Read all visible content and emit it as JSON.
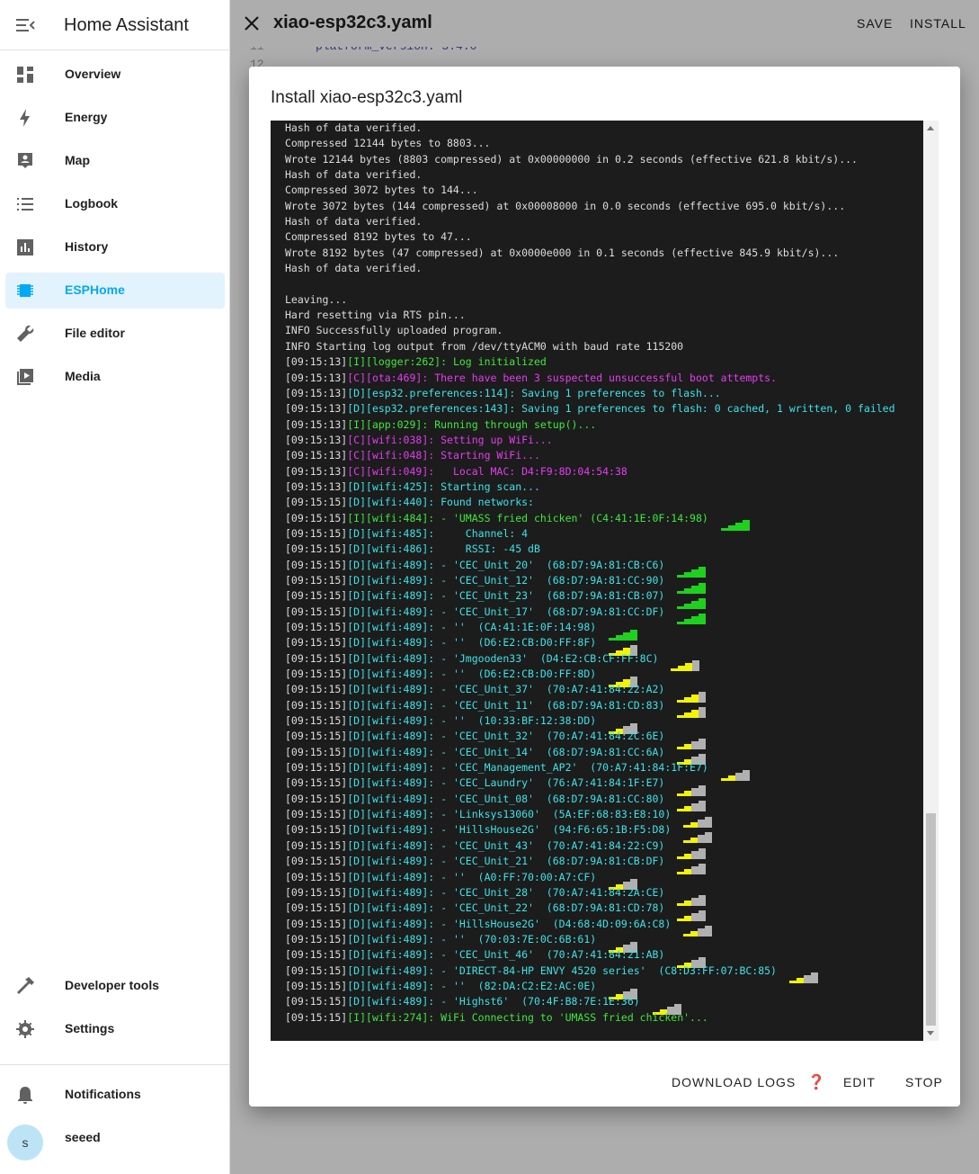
{
  "sidebar": {
    "title": "Home Assistant",
    "items": [
      {
        "label": "Overview",
        "icon": "overview-icon",
        "name": "overview"
      },
      {
        "label": "Energy",
        "icon": "energy-icon",
        "name": "energy"
      },
      {
        "label": "Map",
        "icon": "map-icon",
        "name": "map"
      },
      {
        "label": "Logbook",
        "icon": "logbook-icon",
        "name": "logbook"
      },
      {
        "label": "History",
        "icon": "history-icon",
        "name": "history"
      },
      {
        "label": "ESPHome",
        "icon": "esphome-icon",
        "name": "esphome",
        "active": true
      },
      {
        "label": "File editor",
        "icon": "wrench-icon",
        "name": "file-editor"
      },
      {
        "label": "Media",
        "icon": "media-icon",
        "name": "media"
      }
    ],
    "bottom_items": [
      {
        "label": "Developer tools",
        "icon": "hammer-icon",
        "name": "developer-tools"
      },
      {
        "label": "Settings",
        "icon": "gear-icon",
        "name": "settings"
      }
    ],
    "notifications_label": "Notifications",
    "user": {
      "initial": "s",
      "name": "seeed"
    }
  },
  "editor": {
    "file_title": "xiao-esp32c3.yaml",
    "save_label": "SAVE",
    "install_label": "INSTALL",
    "line_11": "11",
    "line_11_text": "platform_version: 5.4.0",
    "line_12": "12"
  },
  "dialog": {
    "title": "Install xiao-esp32c3.yaml",
    "download_logs_label": "DOWNLOAD LOGS",
    "help_glyph": "❓",
    "edit_label": "EDIT",
    "stop_label": "STOP"
  },
  "colors": {
    "accent": "#03a9f4",
    "log_bg": "#1c1c1c",
    "log_green": "#3ee83e",
    "log_magenta": "#e53cf0",
    "log_cyan": "#3de3e8",
    "signal_green": "#1fd11f",
    "signal_yellow": "#f4f400",
    "signal_gray": "#b0b0b0"
  },
  "log_lines": [
    {
      "ts": "",
      "tag": "",
      "msg": "Hash of data verified.",
      "color": "white"
    },
    {
      "ts": "",
      "tag": "",
      "msg": "Compressed 12144 bytes to 8803...",
      "color": "white"
    },
    {
      "ts": "",
      "tag": "",
      "msg": "Wrote 12144 bytes (8803 compressed) at 0x00000000 in 0.2 seconds (effective 621.8 kbit/s)...",
      "color": "white"
    },
    {
      "ts": "",
      "tag": "",
      "msg": "Hash of data verified.",
      "color": "white"
    },
    {
      "ts": "",
      "tag": "",
      "msg": "Compressed 3072 bytes to 144...",
      "color": "white"
    },
    {
      "ts": "",
      "tag": "",
      "msg": "Wrote 3072 bytes (144 compressed) at 0x00008000 in 0.0 seconds (effective 695.0 kbit/s)...",
      "color": "white"
    },
    {
      "ts": "",
      "tag": "",
      "msg": "Hash of data verified.",
      "color": "white"
    },
    {
      "ts": "",
      "tag": "",
      "msg": "Compressed 8192 bytes to 47...",
      "color": "white"
    },
    {
      "ts": "",
      "tag": "",
      "msg": "Wrote 8192 bytes (47 compressed) at 0x0000e000 in 0.1 seconds (effective 845.9 kbit/s)...",
      "color": "white"
    },
    {
      "ts": "",
      "tag": "",
      "msg": "Hash of data verified.",
      "color": "white"
    },
    {
      "ts": "",
      "tag": "",
      "msg": "",
      "color": "white"
    },
    {
      "ts": "",
      "tag": "",
      "msg": "Leaving...",
      "color": "white"
    },
    {
      "ts": "",
      "tag": "",
      "msg": "Hard resetting via RTS pin...",
      "color": "white"
    },
    {
      "ts": "",
      "tag": "",
      "msg": "INFO Successfully uploaded program.",
      "color": "white"
    },
    {
      "ts": "",
      "tag": "",
      "msg": "INFO Starting log output from /dev/ttyACM0 with baud rate 115200",
      "color": "white"
    },
    {
      "ts": "[09:15:13]",
      "tag": "[I][logger:262]:",
      "msg": " Log initialized",
      "color": "green"
    },
    {
      "ts": "[09:15:13]",
      "tag": "[C][ota:469]:",
      "msg": " There have been 3 suspected unsuccessful boot attempts.",
      "color": "magenta"
    },
    {
      "ts": "[09:15:13]",
      "tag": "[D][esp32.preferences:114]:",
      "msg": " Saving 1 preferences to flash...",
      "color": "cyan"
    },
    {
      "ts": "[09:15:13]",
      "tag": "[D][esp32.preferences:143]:",
      "msg": " Saving 1 preferences to flash: 0 cached, 1 written, 0 failed",
      "color": "cyan"
    },
    {
      "ts": "[09:15:13]",
      "tag": "[I][app:029]:",
      "msg": " Running through setup()...",
      "color": "green"
    },
    {
      "ts": "[09:15:13]",
      "tag": "[C][wifi:038]:",
      "msg": " Setting up WiFi...",
      "color": "magenta"
    },
    {
      "ts": "[09:15:13]",
      "tag": "[C][wifi:048]:",
      "msg": " Starting WiFi...",
      "color": "magenta"
    },
    {
      "ts": "[09:15:13]",
      "tag": "[C][wifi:049]:",
      "msg": "   Local MAC: D4:F9:8D:04:54:38",
      "color": "magenta"
    },
    {
      "ts": "[09:15:13]",
      "tag": "[D][wifi:425]:",
      "msg": " Starting scan...",
      "color": "cyan"
    },
    {
      "ts": "[09:15:15]",
      "tag": "[D][wifi:440]:",
      "msg": " Found networks:",
      "color": "cyan"
    },
    {
      "ts": "[09:15:15]",
      "tag": "[I][wifi:484]:",
      "msg": " - 'UMASS fried chicken' (C4:41:1E:0F:14:98)",
      "color": "green",
      "signal": "g4"
    },
    {
      "ts": "[09:15:15]",
      "tag": "[D][wifi:485]:",
      "msg": "     Channel: 4",
      "color": "cyan"
    },
    {
      "ts": "[09:15:15]",
      "tag": "[D][wifi:486]:",
      "msg": "     RSSI: -45 dB",
      "color": "cyan"
    },
    {
      "ts": "[09:15:15]",
      "tag": "[D][wifi:489]:",
      "msg": " - 'CEC_Unit_20'  (68:D7:9A:81:CB:C6)",
      "color": "cyan",
      "signal": "g4"
    },
    {
      "ts": "[09:15:15]",
      "tag": "[D][wifi:489]:",
      "msg": " - 'CEC_Unit_12'  (68:D7:9A:81:CC:90)",
      "color": "cyan",
      "signal": "g4"
    },
    {
      "ts": "[09:15:15]",
      "tag": "[D][wifi:489]:",
      "msg": " - 'CEC_Unit_23'  (68:D7:9A:81:CB:07)",
      "color": "cyan",
      "signal": "g4"
    },
    {
      "ts": "[09:15:15]",
      "tag": "[D][wifi:489]:",
      "msg": " - 'CEC_Unit_17'  (68:D7:9A:81:CC:DF)",
      "color": "cyan",
      "signal": "g4"
    },
    {
      "ts": "[09:15:15]",
      "tag": "[D][wifi:489]:",
      "msg": " - ''  (CA:41:1E:0F:14:98)",
      "color": "cyan",
      "signal": "g4"
    },
    {
      "ts": "[09:15:15]",
      "tag": "[D][wifi:489]:",
      "msg": " - ''  (D6:E2:CB:D0:FF:8F)",
      "color": "cyan",
      "signal": "y3"
    },
    {
      "ts": "[09:15:15]",
      "tag": "[D][wifi:489]:",
      "msg": " - 'Jmgooden33'  (D4:E2:CB:CF:FF:8C)",
      "color": "cyan",
      "signal": "y3"
    },
    {
      "ts": "[09:15:15]",
      "tag": "[D][wifi:489]:",
      "msg": " - ''  (D6:E2:CB:D0:FF:8D)",
      "color": "cyan",
      "signal": "y3"
    },
    {
      "ts": "[09:15:15]",
      "tag": "[D][wifi:489]:",
      "msg": " - 'CEC_Unit_37'  (70:A7:41:84:22:A2)",
      "color": "cyan",
      "signal": "y3"
    },
    {
      "ts": "[09:15:15]",
      "tag": "[D][wifi:489]:",
      "msg": " - 'CEC_Unit_11'  (68:D7:9A:81:CD:83)",
      "color": "cyan",
      "signal": "y3"
    },
    {
      "ts": "[09:15:15]",
      "tag": "[D][wifi:489]:",
      "msg": " - ''  (10:33:BF:12:38:DD)",
      "color": "cyan",
      "signal": "y2"
    },
    {
      "ts": "[09:15:15]",
      "tag": "[D][wifi:489]:",
      "msg": " - 'CEC_Unit_32'  (70:A7:41:84:2C:6E)",
      "color": "cyan",
      "signal": "y2"
    },
    {
      "ts": "[09:15:15]",
      "tag": "[D][wifi:489]:",
      "msg": " - 'CEC_Unit_14'  (68:D7:9A:81:CC:6A)",
      "color": "cyan",
      "signal": "y2"
    },
    {
      "ts": "[09:15:15]",
      "tag": "[D][wifi:489]:",
      "msg": " - 'CEC_Management_AP2'  (70:A7:41:84:1F:E7)",
      "color": "cyan",
      "signal": "y2"
    },
    {
      "ts": "[09:15:15]",
      "tag": "[D][wifi:489]:",
      "msg": " - 'CEC_Laundry'  (76:A7:41:84:1F:E7)",
      "color": "cyan",
      "signal": "y2"
    },
    {
      "ts": "[09:15:15]",
      "tag": "[D][wifi:489]:",
      "msg": " - 'CEC_Unit_08'  (68:D7:9A:81:CC:80)",
      "color": "cyan",
      "signal": "y2"
    },
    {
      "ts": "[09:15:15]",
      "tag": "[D][wifi:489]:",
      "msg": " - 'Linksys13060'  (5A:EF:68:83:E8:10)",
      "color": "cyan",
      "signal": "y2"
    },
    {
      "ts": "[09:15:15]",
      "tag": "[D][wifi:489]:",
      "msg": " - 'HillsHouse2G'  (94:F6:65:1B:F5:D8)",
      "color": "cyan",
      "signal": "y2"
    },
    {
      "ts": "[09:15:15]",
      "tag": "[D][wifi:489]:",
      "msg": " - 'CEC_Unit_43'  (70:A7:41:84:22:C9)",
      "color": "cyan",
      "signal": "y2"
    },
    {
      "ts": "[09:15:15]",
      "tag": "[D][wifi:489]:",
      "msg": " - 'CEC_Unit_21'  (68:D7:9A:81:CB:DF)",
      "color": "cyan",
      "signal": "y2"
    },
    {
      "ts": "[09:15:15]",
      "tag": "[D][wifi:489]:",
      "msg": " - ''  (A0:FF:70:00:A7:CF)",
      "color": "cyan",
      "signal": "y2"
    },
    {
      "ts": "[09:15:15]",
      "tag": "[D][wifi:489]:",
      "msg": " - 'CEC_Unit_28'  (70:A7:41:84:2A:CE)",
      "color": "cyan",
      "signal": "y2"
    },
    {
      "ts": "[09:15:15]",
      "tag": "[D][wifi:489]:",
      "msg": " - 'CEC_Unit_22'  (68:D7:9A:81:CD:78)",
      "color": "cyan",
      "signal": "y2"
    },
    {
      "ts": "[09:15:15]",
      "tag": "[D][wifi:489]:",
      "msg": " - 'HillsHouse2G'  (D4:68:4D:09:6A:C8)",
      "color": "cyan",
      "signal": "y2"
    },
    {
      "ts": "[09:15:15]",
      "tag": "[D][wifi:489]:",
      "msg": " - ''  (70:03:7E:0C:6B:61)",
      "color": "cyan",
      "signal": "y2"
    },
    {
      "ts": "[09:15:15]",
      "tag": "[D][wifi:489]:",
      "msg": " - 'CEC_Unit_46'  (70:A7:41:84:21:AB)",
      "color": "cyan",
      "signal": "y2"
    },
    {
      "ts": "[09:15:15]",
      "tag": "[D][wifi:489]:",
      "msg": " - 'DIRECT-84-HP ENVY 4520 series'  (C8:D3:FF:07:BC:85)",
      "color": "cyan",
      "signal": "y2"
    },
    {
      "ts": "[09:15:15]",
      "tag": "[D][wifi:489]:",
      "msg": " - ''  (82:DA:C2:E2:AC:0E)",
      "color": "cyan",
      "signal": "y2"
    },
    {
      "ts": "[09:15:15]",
      "tag": "[D][wifi:489]:",
      "msg": " - 'Highst6'  (70:4F:B8:7E:1E:36)",
      "color": "cyan",
      "signal": "y2"
    },
    {
      "ts": "[09:15:15]",
      "tag": "[I][wifi:274]:",
      "msg": " WiFi Connecting to 'UMASS fried chicken'...",
      "color": "green"
    }
  ]
}
